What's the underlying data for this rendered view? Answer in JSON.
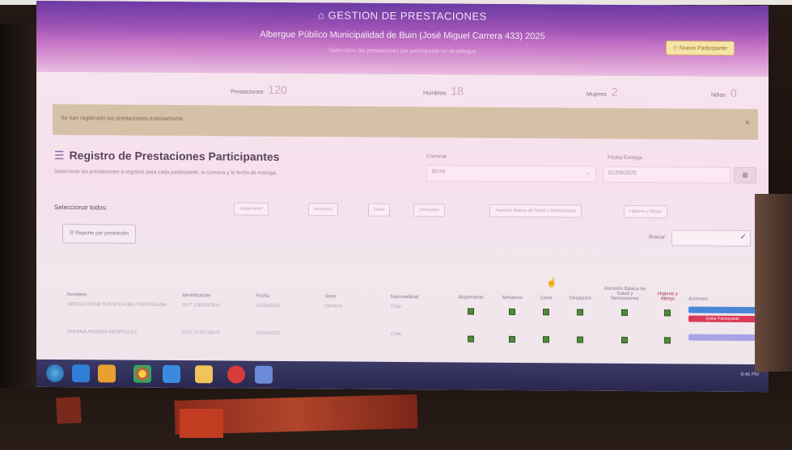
{
  "header": {
    "title": "GESTION DE PRESTACIONES",
    "subtitle": "Albergue Público Municipalidad de Buin (José Miguel Carrera 433) 2025",
    "tagline": "Seleccione las prestaciones por participante en despliegue",
    "new_button": "Nuevo Participante"
  },
  "stats": {
    "prestaciones_label": "Prestaciones",
    "prestaciones_value": "120",
    "hombres_label": "Hombres",
    "hombres_value": "18",
    "mujeres_label": "Mujeres",
    "mujeres_value": "2",
    "ninos_label": "Niños",
    "ninos_value": "0"
  },
  "alert": {
    "message": "Se han registrado las prestaciones exitosamente",
    "close": "×"
  },
  "section": {
    "title": "Registro de Prestaciones Participantes",
    "description": "Seleccione las prestaciones a registrar para cada participante, la comuna y la fecha de entrega.",
    "comuna_label": "Comuna",
    "comuna_value": "BUIN",
    "fecha_label": "Fecha Entrega",
    "fecha_value": "01/09/2025",
    "select_all_label": "Seleccionar todos:",
    "chips": [
      "Alojamiento",
      "Almuerzo",
      "Cena",
      "Desayuno",
      "Atención Básica de Salud y Derivaciones",
      "Higiene y Abrigo"
    ],
    "report_button": "Reporte por prestación",
    "buscar_label": "Buscar:"
  },
  "table": {
    "headers": [
      "Nombres",
      "Identificación",
      "Fecha",
      "Sexo",
      "Nacionalidad",
      "Alojamiento",
      "Almuerzo",
      "Cena",
      "Desayuno",
      "Atención Básica de Salud y Derivaciones",
      "Higiene y Abrigo",
      "Acciones"
    ],
    "rows": [
      {
        "nombre": "SERGIO RENE FUENTEALBA FUENTEALBA",
        "id": "RUT 15838908-K",
        "fecha": "01/09/2025",
        "sexo": "Hombre",
        "nac": "Chile",
        "delete": "Quitar Participante"
      },
      {
        "nombre": "ROMINA ANDREA HENRIQUEZ",
        "id": "RUT 17751783-K",
        "fecha": "01/09/2025",
        "sexo": "",
        "nac": "Chile",
        "delete": ""
      }
    ]
  },
  "taskbar": {
    "clock": "8:46 PM"
  },
  "colors": {
    "header_start": "#6b3aa4",
    "alert_bg": "#cfc3a0",
    "delete_red": "#d93a56",
    "action_blue": "#4a86d8"
  }
}
